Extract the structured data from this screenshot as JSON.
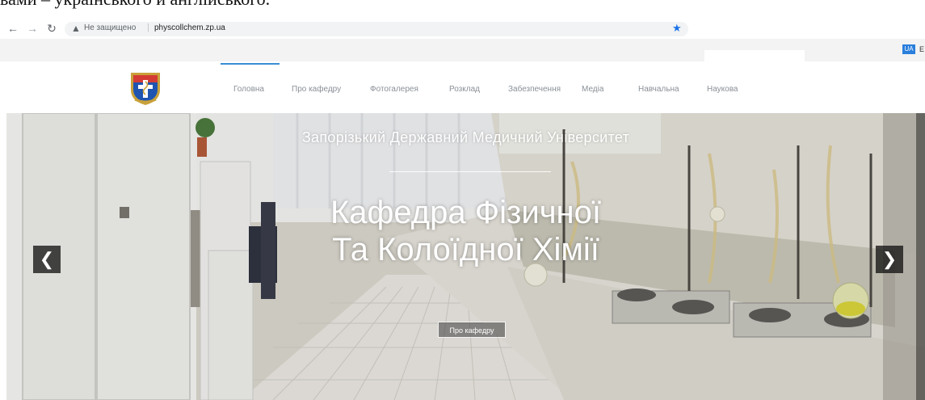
{
  "document_line": "вами – українського и англійського.",
  "browser": {
    "security_warning": "Не защищено",
    "url": "physcollchem.zp.ua",
    "lang_badge": "UA",
    "lang_next": "E"
  },
  "nav": {
    "items": [
      {
        "label": "Головна"
      },
      {
        "label": "Про кафедру"
      },
      {
        "label": "Фотогалерея"
      },
      {
        "label": "Розклад"
      },
      {
        "label": "Забезпечення"
      },
      {
        "label": "Медіа"
      },
      {
        "label": "Навчальна"
      },
      {
        "label": "Наукова"
      }
    ],
    "active_index": 0
  },
  "hero": {
    "subtitle": "Запорізький Державний Медичний Університет",
    "title_line1": "Кафедра Фізичної",
    "title_line2": "Та Колоїдної Хімії",
    "button": "Про кафедру"
  },
  "colors": {
    "accent": "#3a8fd4",
    "lang_badge": "#2a7fdc"
  }
}
